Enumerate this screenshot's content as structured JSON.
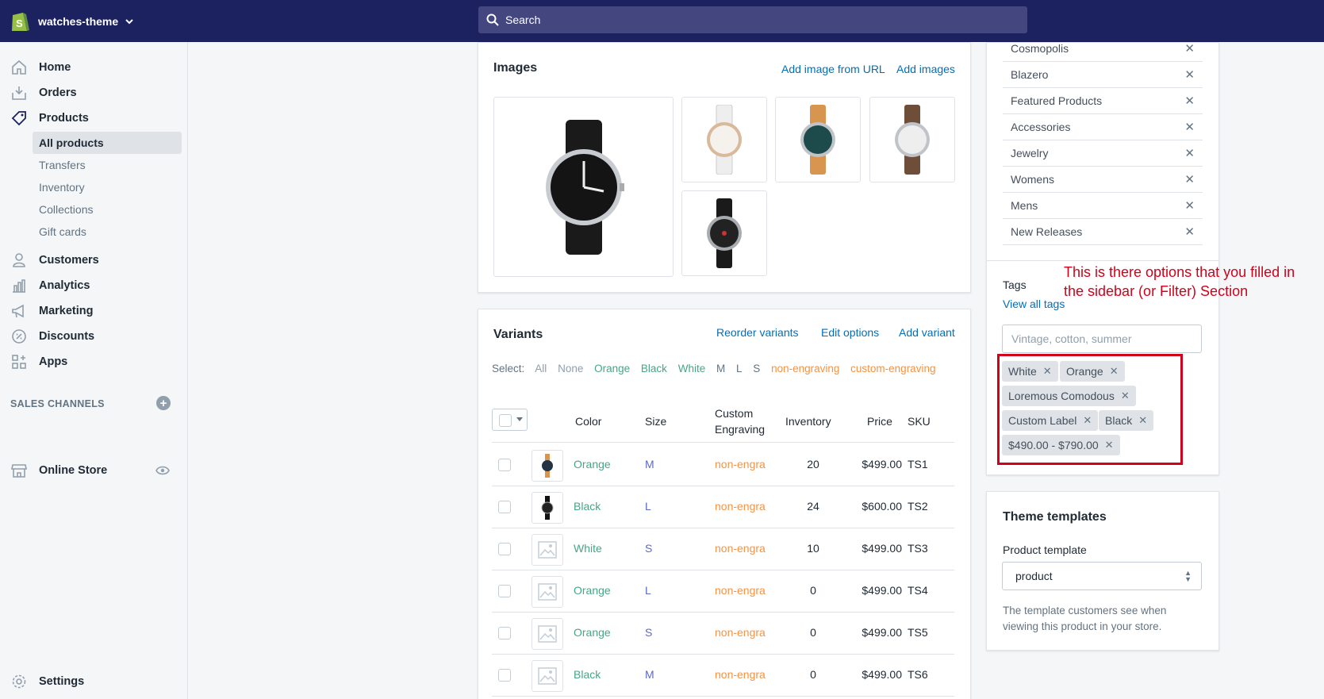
{
  "topbar": {
    "store_name": "watches-theme",
    "search_placeholder": "Search"
  },
  "sidebar": {
    "home": "Home",
    "orders": "Orders",
    "products": "Products",
    "sub": [
      "All products",
      "Transfers",
      "Inventory",
      "Collections",
      "Gift cards"
    ],
    "customers": "Customers",
    "analytics": "Analytics",
    "marketing": "Marketing",
    "discounts": "Discounts",
    "apps": "Apps",
    "sales_channels": "SALES CHANNELS",
    "online_store": "Online Store",
    "settings": "Settings"
  },
  "images": {
    "title": "Images",
    "add_from_url": "Add image from URL",
    "add_images": "Add images"
  },
  "variants": {
    "title": "Variants",
    "reorder": "Reorder variants",
    "edit_options": "Edit options",
    "add_variant": "Add variant",
    "select_label": "Select:",
    "select_options": [
      "All",
      "None",
      "Orange",
      "Black",
      "White",
      "M",
      "L",
      "S",
      "non-engraving",
      "custom-engraving"
    ],
    "headers": {
      "color": "Color",
      "size": "Size",
      "custom1": "Custom",
      "custom2": "Engraving",
      "inventory": "Inventory",
      "price": "Price",
      "sku": "SKU"
    },
    "rows": [
      {
        "color": "Orange",
        "size": "M",
        "engraving": "non-engra",
        "inventory": "20",
        "price": "$499.00",
        "sku": "TS1"
      },
      {
        "color": "Black",
        "size": "L",
        "engraving": "non-engra",
        "inventory": "24",
        "price": "$600.00",
        "sku": "TS2"
      },
      {
        "color": "White",
        "size": "S",
        "engraving": "non-engra",
        "inventory": "10",
        "price": "$499.00",
        "sku": "TS3"
      },
      {
        "color": "Orange",
        "size": "L",
        "engraving": "non-engra",
        "inventory": "0",
        "price": "$499.00",
        "sku": "TS4"
      },
      {
        "color": "Orange",
        "size": "S",
        "engraving": "non-engra",
        "inventory": "0",
        "price": "$499.00",
        "sku": "TS5"
      },
      {
        "color": "Black",
        "size": "M",
        "engraving": "non-engra",
        "inventory": "0",
        "price": "$499.00",
        "sku": "TS6"
      }
    ]
  },
  "collections": [
    "Cosmopolis",
    "Blazero",
    "Featured Products",
    "Accessories",
    "Jewelry",
    "Womens",
    "Mens",
    "New Releases"
  ],
  "tags": {
    "title": "Tags",
    "view_all": "View all tags",
    "placeholder": "Vintage, cotton, summer",
    "items": [
      "White",
      "Orange",
      "Loremous Comodous",
      "Custom Label",
      "Black",
      "$490.00 - $790.00"
    ]
  },
  "annotation": "This is there options that you filled in the sidebar (or Filter) Section",
  "theme": {
    "title": "Theme templates",
    "label": "Product template",
    "value": "product",
    "help": "The template customers see when viewing this product in your store."
  }
}
